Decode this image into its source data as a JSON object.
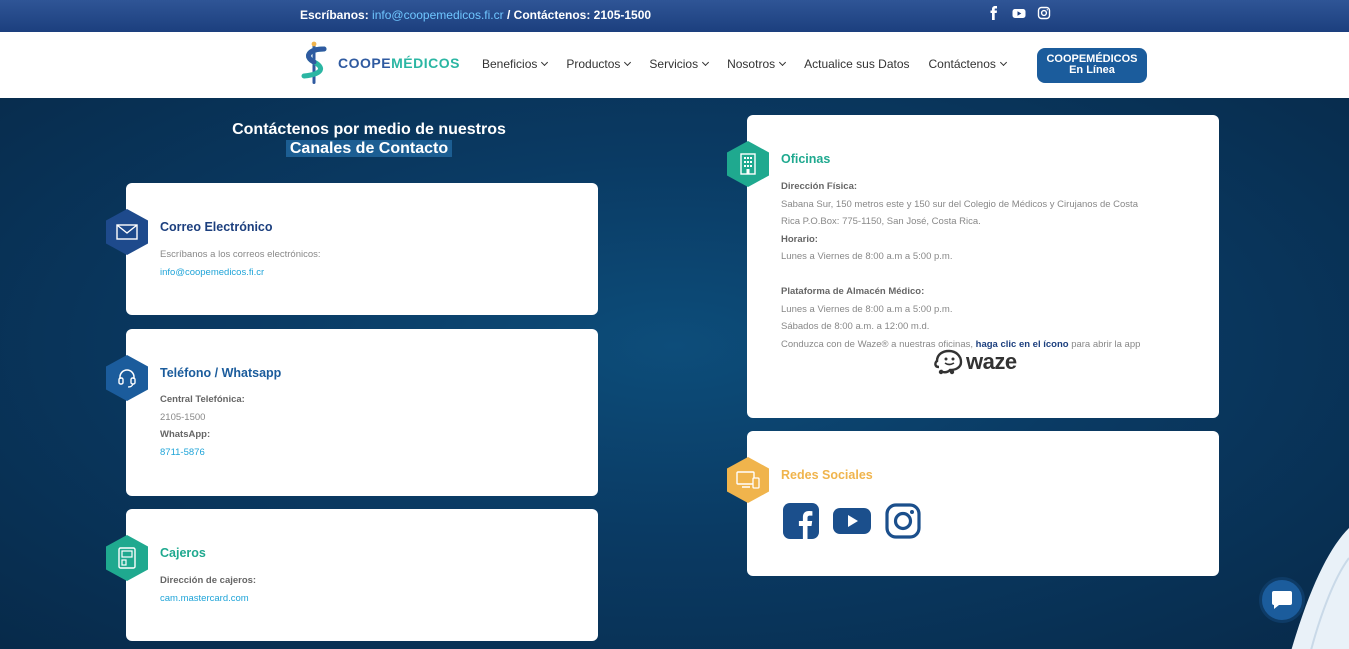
{
  "topbar": {
    "write_label": "Escríbanos:",
    "email": "info@coopemedicos.fi.cr",
    "separator": "/",
    "contact_label": "Contáctenos:",
    "phone": "2105-1500",
    "social_icons": [
      "facebook-icon",
      "youtube-icon",
      "instagram-icon"
    ]
  },
  "header": {
    "logo_part1": "COOPE",
    "logo_part2": "MÉDICOS",
    "nav": [
      {
        "label": "Beneficios",
        "dropdown": true
      },
      {
        "label": "Productos",
        "dropdown": true
      },
      {
        "label": "Servicios",
        "dropdown": true
      },
      {
        "label": "Nosotros",
        "dropdown": true
      },
      {
        "label": "Actualice sus Datos",
        "dropdown": false
      },
      {
        "label": "Contáctenos",
        "dropdown": true
      }
    ],
    "cta_line1": "COOPEMÉDICOS",
    "cta_line2": "En Línea"
  },
  "hero": {
    "line1": "Contáctenos por medio de nuestros",
    "line2": "Canales de Contacto"
  },
  "cards": {
    "email": {
      "title": "Correo Electrónico",
      "text": "Escríbanos a los correos electrónicos:",
      "link": "info@coopemedicos.fi.cr"
    },
    "phone": {
      "title": "Teléfono / Whatsapp",
      "central_label": "Central Telefónica:",
      "central_value": "2105-1500",
      "whatsapp_label": "WhatsApp:",
      "whatsapp_value": "8711-5876"
    },
    "atm": {
      "title": "Cajeros",
      "label": "Dirección de cajeros:",
      "link": "cam.mastercard.com"
    },
    "offices": {
      "title": "Oficinas",
      "address_label": "Dirección Física:",
      "address_line1": "Sabana Sur, 150 metros este y 150 sur del Colegio de Médicos y Cirujanos de Costa",
      "address_line2": "Rica P.O.Box: 775-1150, San José, Costa Rica.",
      "hours_label": "Horario:",
      "hours": "Lunes a Viernes de 8:00 a.m a 5:00 p.m.",
      "platform_label": "Plataforma de Almacén Médico:",
      "platform_hours1": "Lunes a Viernes de 8:00 a.m a 5:00 p.m.",
      "platform_hours2": "Sábados de 8:00 a.m. a 12:00 m.d.",
      "waze_text_pre": "Conduzca con de Waze® a nuestras oficinas,",
      "waze_link": "haga clic en el ícono",
      "waze_text_post": "para abrir la app",
      "waze_logo": "waze"
    },
    "social": {
      "title": "Redes Sociales",
      "icons": [
        "facebook-icon",
        "youtube-icon",
        "instagram-icon"
      ]
    }
  },
  "colors": {
    "topbar": "#1c3f7e",
    "brand_blue": "#2f5aa0",
    "brand_teal": "#2bb6a3",
    "social_orange": "#f0b44c",
    "cta": "#1b5c9c"
  }
}
